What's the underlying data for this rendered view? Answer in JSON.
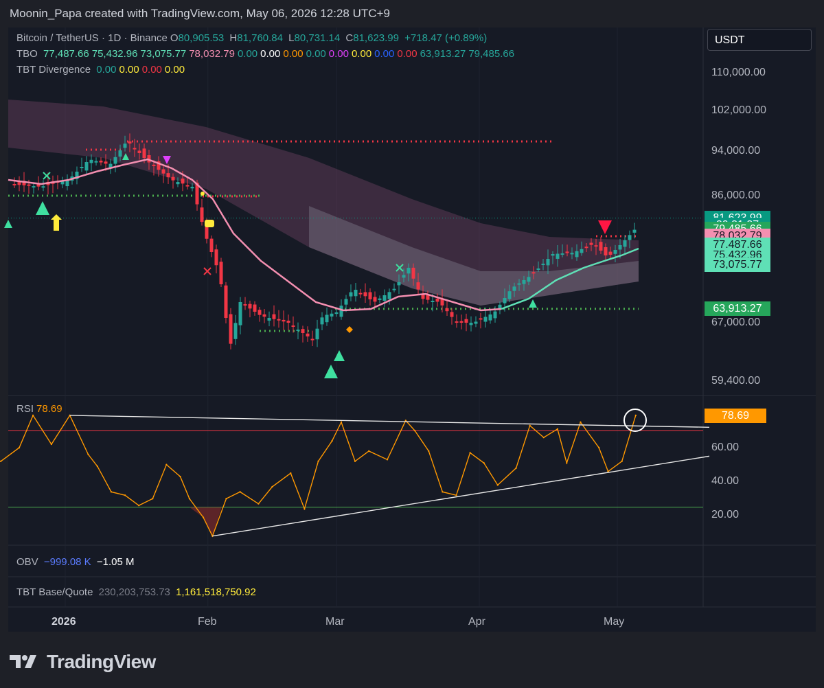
{
  "header": {
    "attribution": "Moonin_Papa created with TradingView.com, May 06, 2026 12:28 UTC+9"
  },
  "toolbar": {
    "currency_button": "USDT"
  },
  "legend": {
    "symbol": "Bitcoin / TetherUS · 1D · Binance",
    "o_label": "O",
    "o_value": "80,905.53",
    "h_label": "H",
    "h_value": "81,760.84",
    "l_label": "L",
    "l_value": "80,731.14",
    "c_label": "C",
    "c_value": "81,623.99",
    "change": "+718.47 (+0.89%)",
    "tbo_name": "TBO",
    "tbo_values": [
      "77,487.66",
      "75,432.96",
      "73,075.77",
      "78,032.79",
      "0.00",
      "0.00",
      "0.00",
      "0.00",
      "0.00",
      "0.00",
      "0.00",
      "0.00",
      "63,913.27",
      "79,485.66"
    ],
    "tbo_colors": [
      "#5fe0b6",
      "#5fe0b6",
      "#5fe0b6",
      "#f48fb1",
      "#26a69a",
      "#ffffff",
      "#ff9800",
      "#26a69a",
      "#e040fb",
      "#ffeb3b",
      "#2962ff",
      "#f23645",
      "#26a69a",
      "#26a69a"
    ],
    "div_name": "TBT Divergence",
    "div_values": [
      "0.00",
      "0.00",
      "0.00",
      "0.00"
    ],
    "div_colors": [
      "#26a69a",
      "#ffeb3b",
      "#f23645",
      "#ffeb3b"
    ],
    "rsi_name": "RSI",
    "rsi_value": "78.69",
    "obv_name": "OBV",
    "obv_v1": "−999.08 K",
    "obv_v2": "−1.05 M",
    "tbt_name": "TBT Base/Quote",
    "tbt_v1": "230,203,753.73",
    "tbt_v2": "1,161,518,750.92"
  },
  "price_axis": [
    "110,000.00",
    "102,000.00",
    "94,000.00",
    "86,000.00",
    "67,000.00",
    "59,400.00"
  ],
  "price_tags": [
    {
      "text": "81,623.99",
      "bg": "#089981",
      "price": 81624
    },
    {
      "text": "20:31:37",
      "bg": "#089981",
      "price": 80300
    },
    {
      "text": "79,485.66",
      "bg": "#26a65b",
      "price": 79486
    },
    {
      "text": "78,032.79",
      "bg": "#f48fb1",
      "price": 78033
    },
    {
      "text": "77,487.66",
      "bg": "#5fe0b6",
      "price": 76300
    },
    {
      "text": "75,432.96",
      "bg": "#5fe0b6",
      "price": 74350
    },
    {
      "text": "73,075.77",
      "bg": "#5fe0b6",
      "price": 72400
    },
    {
      "text": "63,913.27",
      "bg": "#26a65b",
      "price": 63913
    }
  ],
  "rsi_axis": [
    "60.00",
    "40.00",
    "20.00"
  ],
  "rsi_tag": "78.69",
  "time_axis": [
    "2026",
    "Feb",
    "Mar",
    "Apr",
    "May"
  ],
  "brand": "TradingView",
  "chart_data": {
    "type": "line",
    "series": [
      {
        "name": "RSI",
        "x": [
          "2025-12-08",
          "2025-12-12",
          "2025-12-18",
          "2025-12-22",
          "2025-12-25",
          "2025-12-29",
          "2026-01-02",
          "2026-01-06",
          "2026-01-08",
          "2026-01-11",
          "2026-01-14",
          "2026-01-17",
          "2026-01-20",
          "2026-01-23",
          "2026-01-26",
          "2026-01-28",
          "2026-01-31",
          "2026-02-02",
          "2026-02-05",
          "2026-02-08",
          "2026-02-12",
          "2026-02-15",
          "2026-02-19",
          "2026-02-22",
          "2026-02-25",
          "2026-02-28",
          "2026-03-02",
          "2026-03-05",
          "2026-03-08",
          "2026-03-12",
          "2026-03-16",
          "2026-03-18",
          "2026-03-21",
          "2026-03-24",
          "2026-03-27",
          "2026-03-30",
          "2026-04-02",
          "2026-04-05",
          "2026-04-09",
          "2026-04-12",
          "2026-04-15",
          "2026-04-18",
          "2026-04-20",
          "2026-04-23",
          "2026-04-27",
          "2026-04-29",
          "2026-05-02",
          "2026-05-05"
        ],
        "values": [
          48,
          50,
          52,
          60,
          79,
          62,
          79,
          56,
          49,
          34,
          32,
          26,
          30,
          50,
          43,
          30,
          19,
          8,
          30,
          34,
          27,
          37,
          45,
          24,
          52,
          64,
          75,
          52,
          58,
          53,
          76,
          70,
          58,
          34,
          32,
          57,
          51,
          38,
          48,
          73,
          66,
          71,
          51,
          75,
          60,
          46,
          52,
          79
        ]
      }
    ],
    "price_range_visible": [
      56000,
      114000
    ],
    "key_levels": {
      "resistance_dotted": 96600,
      "support_dotted": 63913,
      "last_close": 81623.99
    },
    "rsi_levels": {
      "overbought": 70,
      "oversold": 25,
      "ylim": [
        5,
        85
      ]
    },
    "trendlines": [
      {
        "from": [
          "2026-01-02",
          79
        ],
        "to": [
          "2026-05-21",
          72
        ]
      },
      {
        "from": [
          "2026-02-02",
          8
        ],
        "to": [
          "2026-05-21",
          55
        ]
      }
    ]
  }
}
